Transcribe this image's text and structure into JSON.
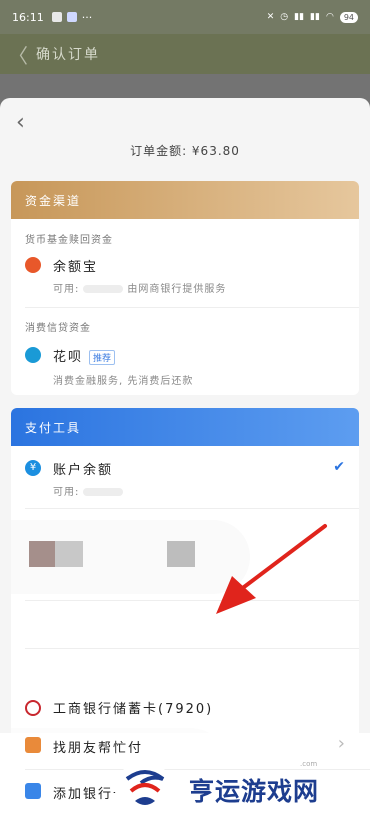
{
  "status_bar": {
    "time": "16:11",
    "more": "···",
    "battery": "94"
  },
  "page_title": "确认订单",
  "sheet": {
    "amount_label": "订单金额: ¥63.80",
    "fund_channel": {
      "header": "资金渠道",
      "section_fund": "货币基金赎回资金",
      "yuebao": {
        "title": "余额宝",
        "sub_prefix": "可用:",
        "sub_suffix": "由网商银行提供服务"
      },
      "section_credit": "消费信贷资金",
      "huabei": {
        "title": "花呗",
        "tag": "推荐",
        "sub": "消费金融服务, 先消费后还款"
      }
    },
    "pay_tools": {
      "header": "支付工具",
      "balance": {
        "title": "账户余额",
        "sub_prefix": "可用:"
      },
      "icbc": {
        "title": "工商银行储蓄卡(7920)"
      },
      "friend_pay": {
        "title": "找朋友帮忙付"
      },
      "add_card": {
        "title": "添加银行卡"
      }
    }
  },
  "watermark": {
    "text": "亨运游戏网",
    "small": ".com"
  },
  "colors": {
    "accent_blue": "#2b74e0",
    "gold": "#c79759",
    "arrow_red": "#e0241c"
  },
  "icons": [
    "back-chevron-icon",
    "yuebao-icon",
    "huabei-icon",
    "balance-yen-icon",
    "icbc-icon",
    "friend-pay-icon",
    "bank-card-icon",
    "checkmark-icon"
  ]
}
